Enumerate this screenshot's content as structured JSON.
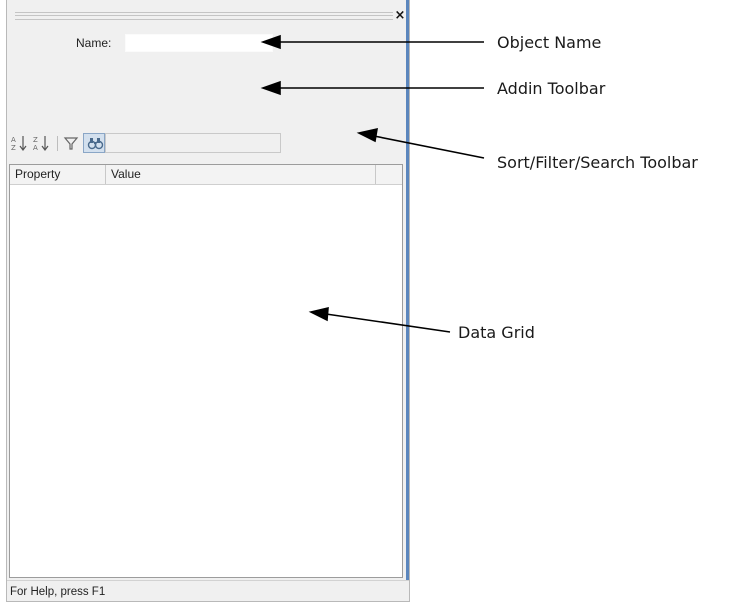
{
  "panel": {
    "close_symbol": "×",
    "name_label": "Name:",
    "name_value": "",
    "toolbar": {
      "sort_ascending_glyph": "A↓",
      "sort_descending_glyph": "Z↓",
      "filter_glyph": "▽",
      "search_glyph": "🔍",
      "search_value": ""
    },
    "grid": {
      "columns": [
        "Property",
        "Value",
        ""
      ]
    },
    "status_text": "For Help, press F1"
  },
  "callouts": {
    "object_name": "Object Name",
    "addin_toolbar": "Addin Toolbar",
    "sort_filter_search": "Sort/Filter/Search Toolbar",
    "data_grid": "Data Grid"
  }
}
